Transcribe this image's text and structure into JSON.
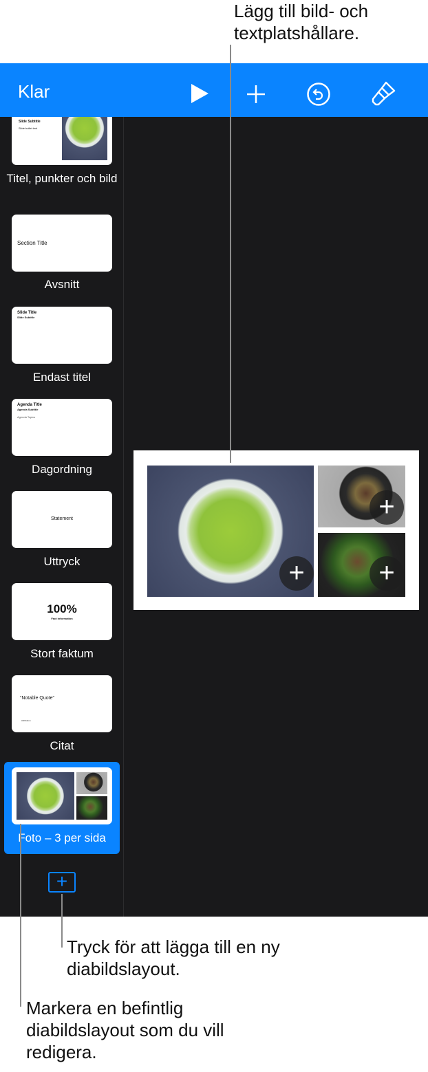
{
  "callouts": {
    "top": "Lägg till bild- och textplatshållare.",
    "add": "Tryck för att lägga till en ny diabildslayout.",
    "select": "Markera en befintlig diabildslayout som du vill redigera."
  },
  "toolbar": {
    "done_label": "Klar",
    "icons": [
      "play-icon",
      "plus-icon",
      "undo-icon",
      "paintbrush-icon"
    ]
  },
  "colors": {
    "accent": "#0a84ff",
    "background": "#19191b"
  },
  "layouts": [
    {
      "label": "Titel, punkter och bild",
      "thumb": {
        "subtitle": "Slide Subtitle",
        "bullet": "Slide bullet text"
      }
    },
    {
      "label": "Avsnitt",
      "thumb": {
        "title": "Section Title"
      }
    },
    {
      "label": "Endast titel",
      "thumb": {
        "title": "Slide Title",
        "subtitle": "Slide Subtitle"
      }
    },
    {
      "label": "Dagordning",
      "thumb": {
        "title": "Agenda Title",
        "subtitle": "Agenda Subtitle",
        "body": "Agenda Topics"
      }
    },
    {
      "label": "Uttryck",
      "thumb": {
        "title": "Statement"
      }
    },
    {
      "label": "Stort faktum",
      "thumb": {
        "title": "100%",
        "subtitle": "Fact information"
      }
    },
    {
      "label": "Citat",
      "thumb": {
        "title": "“Notable Quote”",
        "subtitle": "Attribution"
      }
    },
    {
      "label": "Foto – 3 per sida",
      "selected": true
    }
  ],
  "add_layout_icon": "plus-square-icon",
  "slide": {
    "placeholder_icon": "+"
  }
}
